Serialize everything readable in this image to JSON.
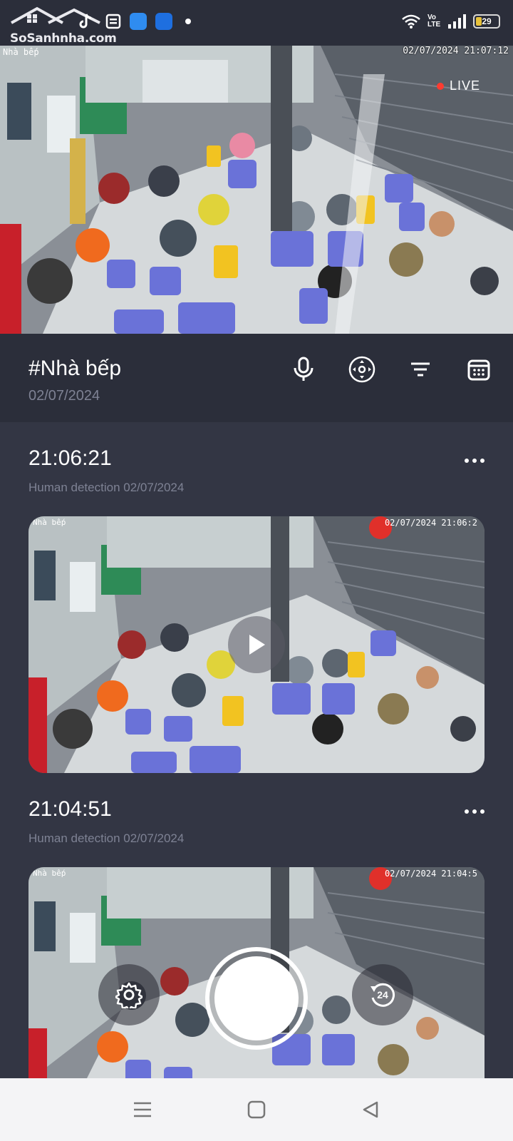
{
  "status_bar": {
    "watermark_text": "SoSanhnha.com",
    "network_label": "Vo LTE",
    "battery_level": "29"
  },
  "live_feed": {
    "camera_label": "Nhà bếp",
    "timestamp": "02/07/2024 21:07:12",
    "live_label": "LIVE"
  },
  "header": {
    "camera_name": "#Nhà bếp",
    "date": "02/07/2024",
    "actions": [
      "microphone-icon",
      "ptz-control-icon",
      "filter-icon",
      "calendar-icon"
    ]
  },
  "events": [
    {
      "time": "21:06:21",
      "description": "Human detection 02/07/2024",
      "thumb_label": "Nhà bếp",
      "thumb_timestamp": "02/07/2024 21:06:2"
    },
    {
      "time": "21:04:51",
      "description": "Human detection 02/07/2024",
      "thumb_label": "Nhà bếp",
      "thumb_timestamp": "02/07/2024 21:04:5"
    }
  ],
  "capture_controls": {
    "replay_label": "24"
  },
  "colors": {
    "background": "#2b2e3a",
    "list_background": "#333644",
    "secondary_text": "#7e8294",
    "live_dot": "#ff3b30"
  }
}
